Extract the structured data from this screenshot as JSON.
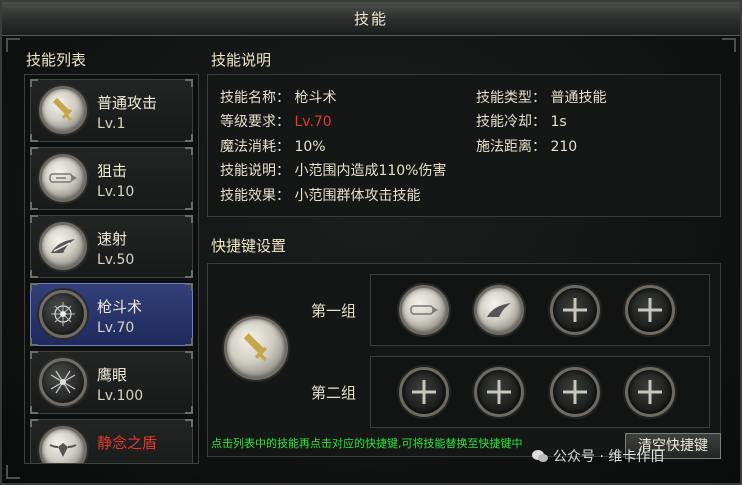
{
  "window": {
    "title": "技能"
  },
  "skill_list": {
    "title": "技能列表",
    "items": [
      {
        "name": "普通攻击",
        "level": "Lv.1",
        "icon": "sword-icon",
        "selected": false
      },
      {
        "name": "狙击",
        "level": "Lv.10",
        "icon": "bullet-icon",
        "selected": false
      },
      {
        "name": "速射",
        "level": "Lv.50",
        "icon": "wing-arrow-icon",
        "selected": false
      },
      {
        "name": "枪斗术",
        "level": "Lv.70",
        "icon": "gunplay-icon",
        "selected": true
      },
      {
        "name": "鹰眼",
        "level": "Lv.100",
        "icon": "hawkeye-icon",
        "selected": false
      },
      {
        "name": "静念之盾",
        "level": "",
        "icon": "shield-wings-icon",
        "selected": false
      }
    ]
  },
  "description": {
    "title": "技能说明",
    "name_label": "技能名称：",
    "name_value": "枪斗术",
    "type_label": "技能类型：",
    "type_value": "普通技能",
    "req_label": "等级要求：",
    "req_value": "Lv.70",
    "cooldown_label": "技能冷却：",
    "cooldown_value": "1s",
    "mana_label": "魔法消耗：",
    "mana_value": "10%",
    "range_label": "施法距离：",
    "range_value": "210",
    "desc_label": "技能说明：",
    "desc_value": "小范围内造成110%伤害",
    "effect_label": "技能效果：",
    "effect_value": "小范围群体攻击技能"
  },
  "shortcut": {
    "title": "快捷键设置",
    "group1_label": "第一组",
    "group2_label": "第二组",
    "hint": "点击列表中的技能再点击对应的快捷键,可将技能替换至快捷键中",
    "clear_button": "清空快捷键"
  },
  "watermark": "公众号 · 维卡作旧",
  "colors": {
    "highlight_red": "#e3392c",
    "hint_green": "#2ee33a",
    "selected_blue": "#2a3670"
  }
}
